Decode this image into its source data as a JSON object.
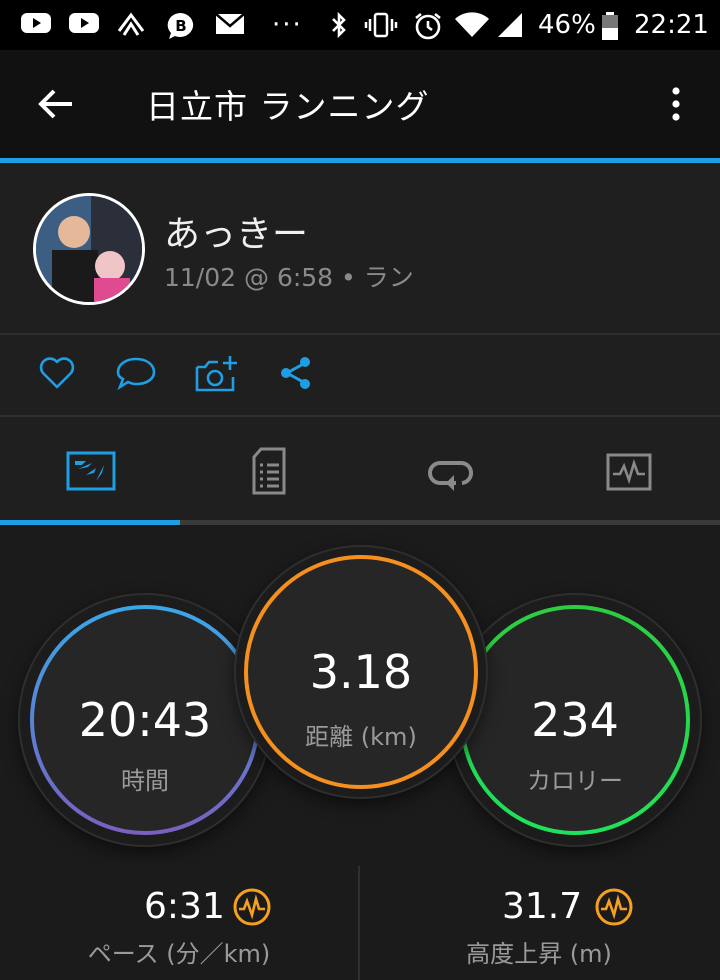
{
  "status_bar": {
    "icons": [
      "youtube-icon",
      "youtube-icon",
      "tosho-icon",
      "b-messenger-icon",
      "yahoo-mail-icon",
      "more-notifications-icon",
      "bluetooth-icon",
      "vibrate-icon",
      "alarm-icon",
      "wifi-icon",
      "signal-icon",
      "battery-icon"
    ],
    "more": "···",
    "battery": "46%",
    "time": "22:21"
  },
  "app_bar": {
    "back_icon": "arrow-back-icon",
    "title": "日立市 ランニング",
    "menu_icon": "more-vert-icon"
  },
  "profile": {
    "name": "あっきー",
    "meta": "11/02 @ 6:58 • ラン"
  },
  "actions": [
    "heart-icon",
    "comment-icon",
    "add-photo-icon",
    "share-icon"
  ],
  "tabs": {
    "items": [
      "overview-icon",
      "details-icon",
      "laps-icon",
      "charts-icon"
    ],
    "active": 0
  },
  "stats": {
    "time": {
      "value": "20:43",
      "label": "時間"
    },
    "distance": {
      "value": "3.18",
      "label": "距離 (km)"
    },
    "calories": {
      "value": "234",
      "label": "カロリー"
    }
  },
  "bottom": {
    "pace": {
      "value": "6:31",
      "label": "ペース (分／km)",
      "icon": "pulse-icon"
    },
    "elevation": {
      "value": "31.7",
      "label": "高度上昇 (m)",
      "icon": "pulse-icon"
    }
  },
  "colors": {
    "accent": "#1e9ee3",
    "time_ring": [
      "#3aa7e8",
      "#7a5fc0"
    ],
    "distance_ring": "#f5901e",
    "calories_ring": [
      "#2ecc40",
      "#1ee35a"
    ],
    "pulse_icon": "#f5a01e"
  }
}
